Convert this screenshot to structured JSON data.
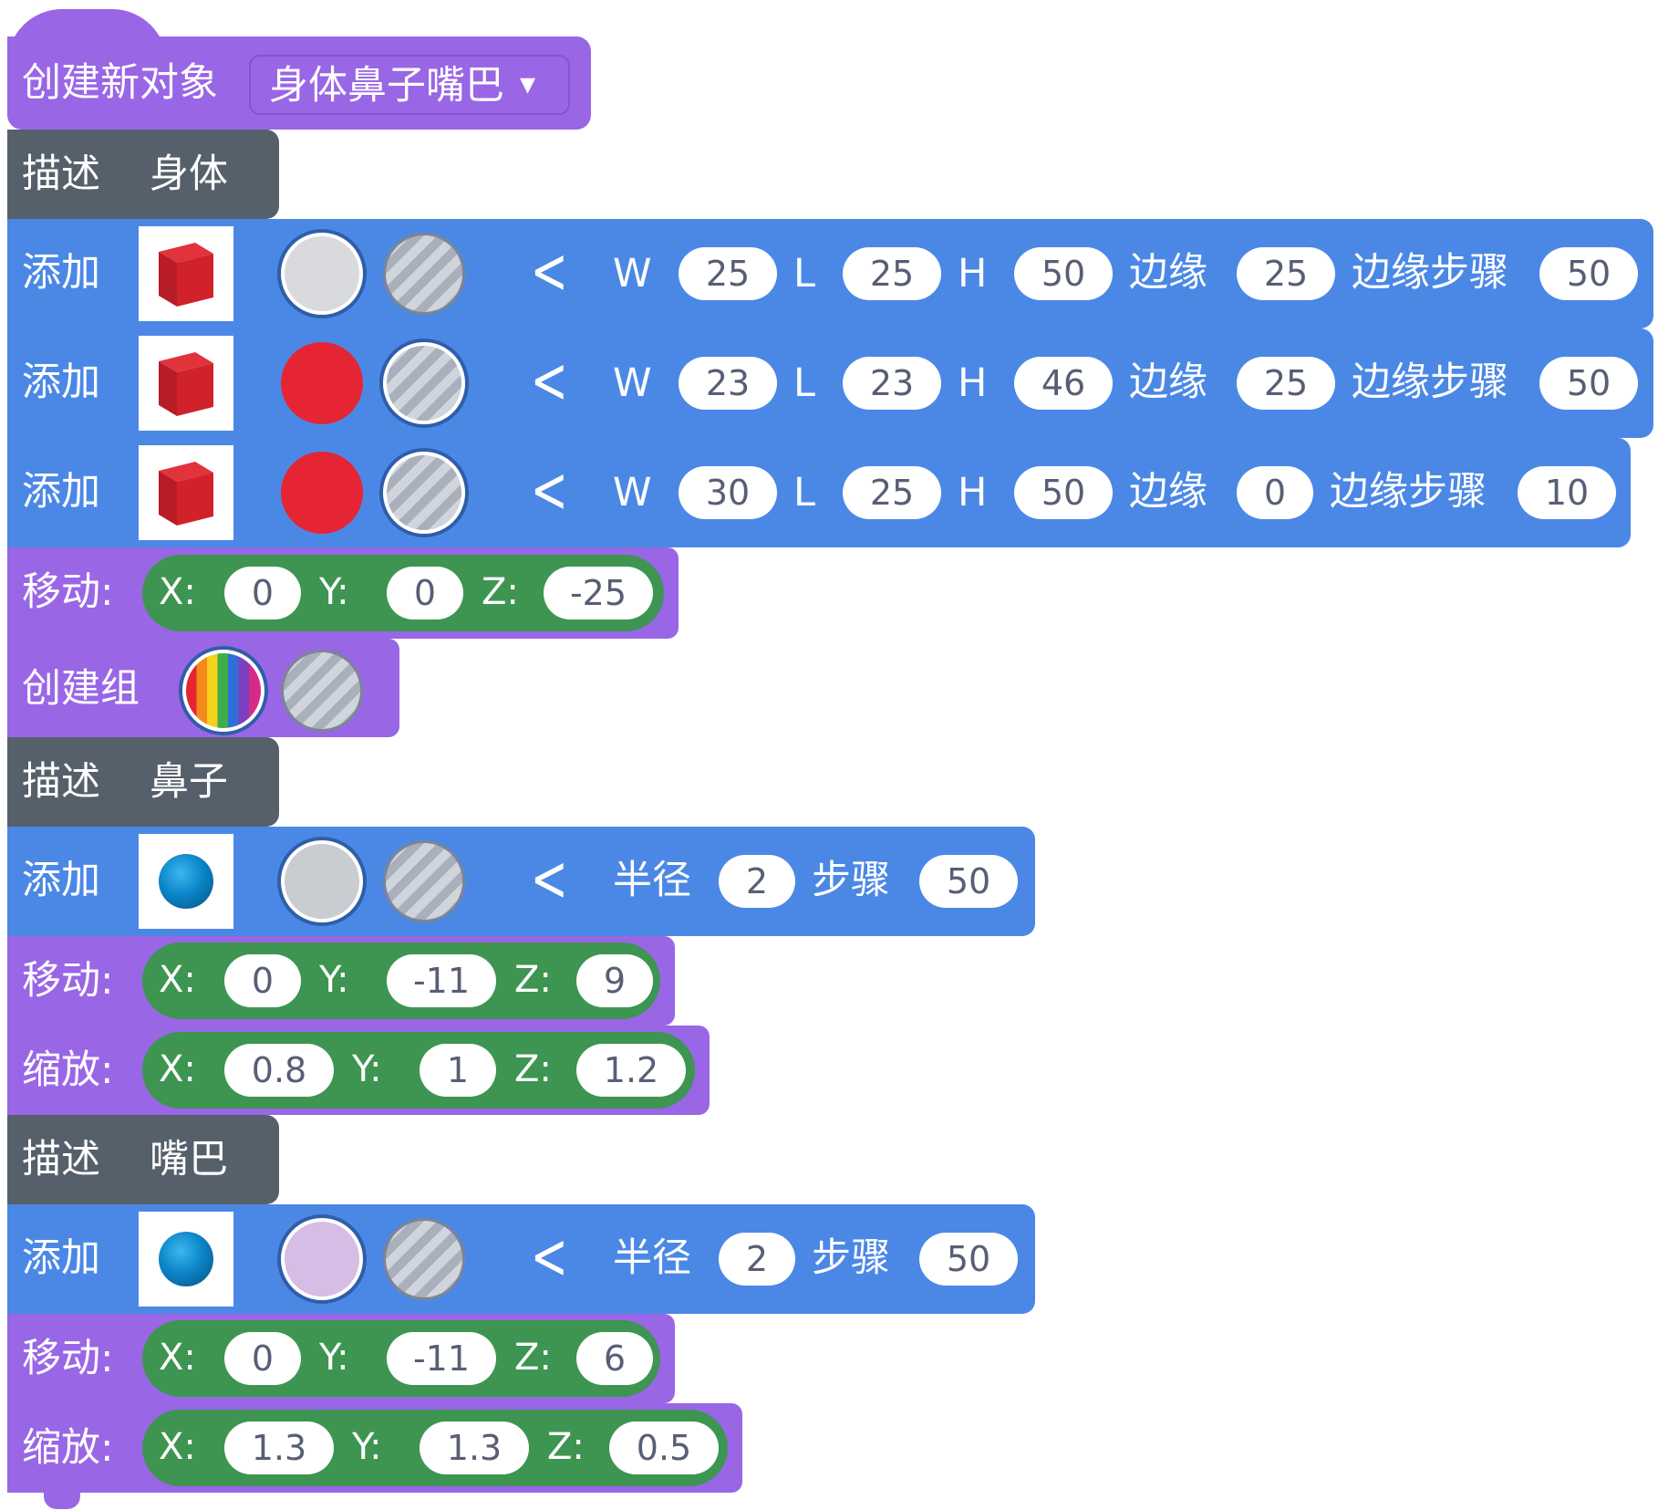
{
  "create": {
    "label": "创建新对象",
    "dropdown": "身体鼻子嘴巴",
    "arrow": "▾"
  },
  "describe1": {
    "label": "描述",
    "value": "身体"
  },
  "add_rows": [
    {
      "label": "添加",
      "W": "W",
      "wv": "25",
      "L": "L",
      "lv": "25",
      "H": "H",
      "hv": "50",
      "edge": "边缘",
      "ev": "25",
      "step": "边缘步骤",
      "sv": "50"
    },
    {
      "label": "添加",
      "W": "W",
      "wv": "23",
      "L": "L",
      "lv": "23",
      "H": "H",
      "hv": "46",
      "edge": "边缘",
      "ev": "25",
      "step": "边缘步骤",
      "sv": "50"
    },
    {
      "label": "添加",
      "W": "W",
      "wv": "30",
      "L": "L",
      "lv": "25",
      "H": "H",
      "hv": "50",
      "edge": "边缘",
      "ev": "0",
      "step": "边缘步骤",
      "sv": "10"
    }
  ],
  "move1": {
    "label": "移动:",
    "x": "X:",
    "xv": "0",
    "y": "Y:",
    "yv": "0",
    "z": "Z:",
    "zv": "-25"
  },
  "group": {
    "label": "创建组"
  },
  "describe2": {
    "label": "描述",
    "value": "鼻子"
  },
  "sphere1": {
    "label": "添加",
    "radius": "半径",
    "rv": "2",
    "step": "步骤",
    "sv": "50"
  },
  "move2": {
    "label": "移动:",
    "x": "X:",
    "xv": "0",
    "y": "Y:",
    "yv": "-11",
    "z": "Z:",
    "zv": "9"
  },
  "scale1": {
    "label": "缩放:",
    "x": "X:",
    "xv": "0.8",
    "y": "Y:",
    "yv": "1",
    "z": "Z:",
    "zv": "1.2"
  },
  "describe3": {
    "label": "描述",
    "value": "嘴巴"
  },
  "sphere2": {
    "label": "添加",
    "radius": "半径",
    "rv": "2",
    "step": "步骤",
    "sv": "50"
  },
  "move3": {
    "label": "移动:",
    "x": "X:",
    "xv": "0",
    "y": "Y:",
    "yv": "-11",
    "z": "Z:",
    "zv": "6"
  },
  "scale2": {
    "label": "缩放:",
    "x": "X:",
    "xv": "1.3",
    "y": "Y:",
    "yv": "1.3",
    "z": "Z:",
    "zv": "0.5"
  },
  "colors": {
    "purple": "#9966e6",
    "blue": "#4b88e6",
    "dark": "#56606b",
    "green": "#3d9551",
    "red": "#e52533",
    "grey": "#d8dadd",
    "lilac": "#d5bde6"
  }
}
